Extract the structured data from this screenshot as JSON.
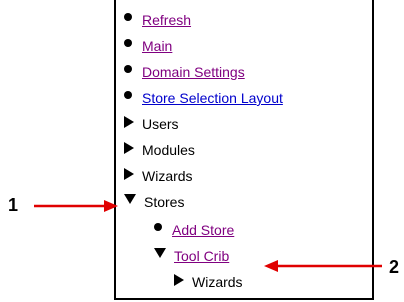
{
  "nav": {
    "items": [
      {
        "label": "Refresh",
        "style": "purple-link",
        "marker": "bullet"
      },
      {
        "label": "Main",
        "style": "purple-link",
        "marker": "bullet"
      },
      {
        "label": "Domain Settings",
        "style": "purple-link",
        "marker": "bullet"
      },
      {
        "label": "Store Selection Layout",
        "style": "blue-link",
        "marker": "bullet"
      },
      {
        "label": "Users",
        "style": "plain",
        "marker": "triangle-right"
      },
      {
        "label": "Modules",
        "style": "plain",
        "marker": "triangle-right"
      },
      {
        "label": "Wizards",
        "style": "plain",
        "marker": "triangle-right"
      },
      {
        "label": "Stores",
        "style": "plain",
        "marker": "triangle-down"
      },
      {
        "label": "Add Store",
        "style": "purple-link",
        "marker": "bullet"
      },
      {
        "label": "Tool Crib",
        "style": "purple-link",
        "marker": "triangle-down"
      },
      {
        "label": "Wizards",
        "style": "plain",
        "marker": "triangle-right"
      }
    ]
  },
  "callouts": {
    "one": "1",
    "two": "2"
  },
  "colors": {
    "link_purple": "#800080",
    "link_blue": "#0000cc",
    "arrow_red": "#e00000"
  }
}
